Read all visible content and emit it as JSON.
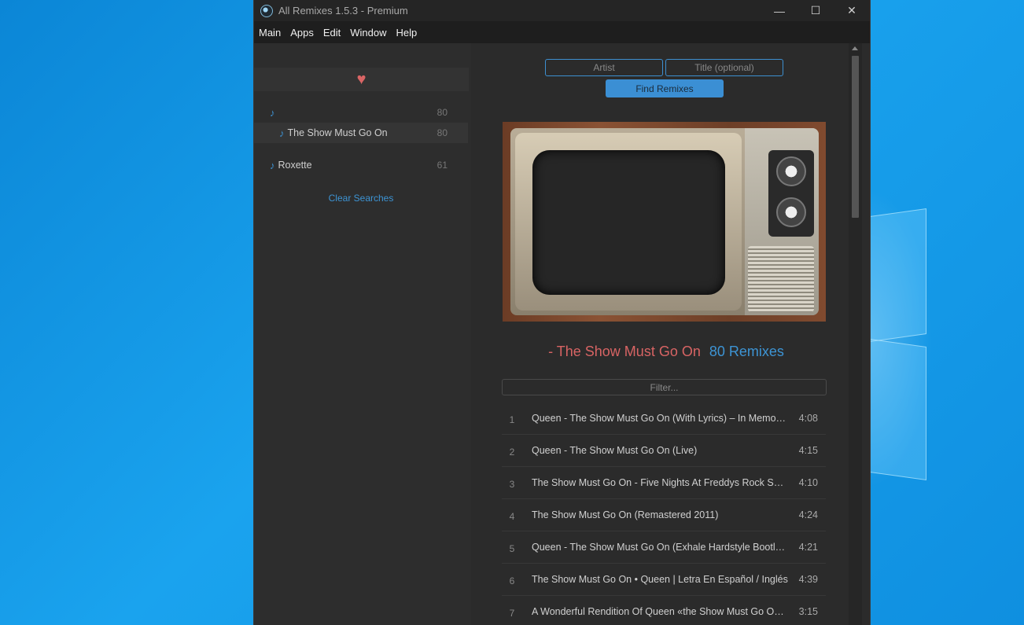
{
  "window": {
    "title": "All Remixes 1.5.3 - Premium",
    "controls": {
      "minimize": "—",
      "maximize": "☐",
      "close": "✕"
    }
  },
  "menu": [
    "Main",
    "Apps",
    "Edit",
    "Window",
    "Help"
  ],
  "sidebar": {
    "heart": "♥",
    "items": [
      {
        "note": "♪",
        "label": "",
        "count": "80"
      },
      {
        "note": "♪",
        "label": "The Show Must Go On",
        "count": "80"
      },
      {
        "note": "♪",
        "label": "Roxette",
        "count": "61"
      }
    ],
    "clear_label": "Clear Searches"
  },
  "search": {
    "artist_placeholder": "Artist",
    "title_placeholder": "Title (optional)",
    "find_label": "Find Remixes"
  },
  "headline": {
    "song": "- The Show Must Go On",
    "count": "80 Remixes"
  },
  "filter": {
    "placeholder": "Filter..."
  },
  "tracks": [
    {
      "num": "1",
      "name": "Queen - The Show Must Go On (With Lyrics) – In Memory …",
      "duration": "4:08"
    },
    {
      "num": "2",
      "name": "Queen - The Show Must Go On (Live)",
      "duration": "4:15"
    },
    {
      "num": "3",
      "name": "The Show Must Go On - Five Nights At Freddys Rock Song…",
      "duration": "4:10"
    },
    {
      "num": "4",
      "name": "The Show Must Go On (Remastered 2011)",
      "duration": "4:24"
    },
    {
      "num": "5",
      "name": "Queen - The Show Must Go On (Exhale Hardstyle Bootleg)…",
      "duration": "4:21"
    },
    {
      "num": "6",
      "name": "The Show Must Go On • Queen | Letra En Español / Inglés",
      "duration": "4:39"
    },
    {
      "num": "7",
      "name": "A Wonderful Rendition Of Queen «the Show Must Go On». …",
      "duration": "3:15"
    }
  ],
  "colors": {
    "accent": "#3d94d4",
    "song_title": "#d86464",
    "heart": "#d96565"
  }
}
